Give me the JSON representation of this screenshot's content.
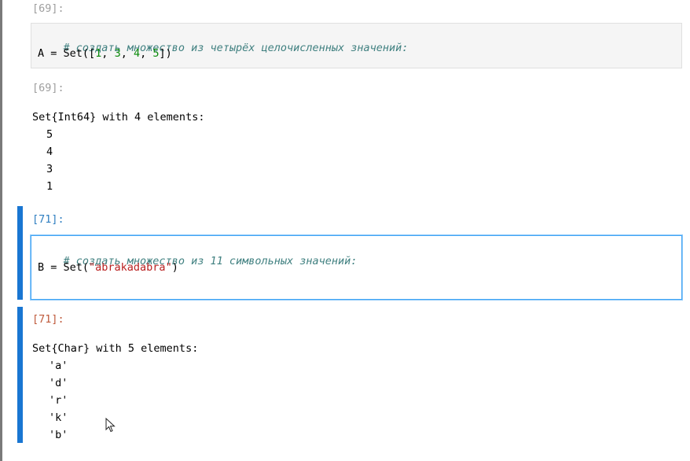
{
  "cells": [
    {
      "input_prompt": "[69]:",
      "code": {
        "comment": "# создать множество из четырёх целочисленных значений:",
        "line2": {
          "lhs": "A = Set([",
          "n1": "1",
          "sep1": ", ",
          "n2": "3",
          "sep2": ", ",
          "n3": "4",
          "sep3": ", ",
          "n4": "5",
          "rhs": "])"
        }
      },
      "output_prompt": "[69]:",
      "output": {
        "header": "Set{Int64} with 4 elements:",
        "items": [
          "5",
          "4",
          "3",
          "1"
        ]
      }
    },
    {
      "input_prompt": "[71]:",
      "code": {
        "comment": "# создать множество из 11 символьных значений:",
        "line2": {
          "lhs": "B = Set(",
          "str": "\"abrakadabra\"",
          "rhs": ")"
        }
      },
      "output_prompt": "[71]:",
      "output": {
        "header": "Set{Char} with 5 elements:",
        "items": [
          "'a'",
          "'d'",
          "'r'",
          "'k'",
          "'b'"
        ]
      }
    }
  ],
  "colors": {
    "active_bar": "#1976d2",
    "prompt_in_active": "#307fc1",
    "prompt_out_active": "#bf5b3d",
    "prompt_inactive": "#9e9e9e",
    "comment": "#408080",
    "number": "#0a8a0a",
    "string": "#ba2121"
  },
  "icons": {
    "cursor": "mouse-pointer-icon"
  }
}
